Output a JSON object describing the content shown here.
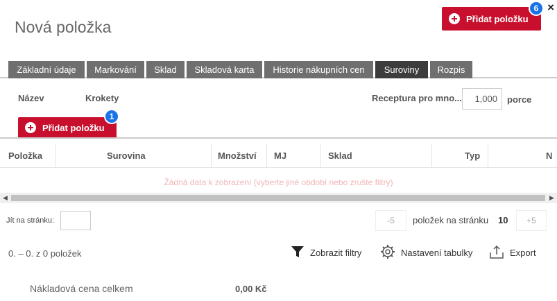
{
  "dialog": {
    "title": "Nová položka",
    "close_symbol": "×"
  },
  "header_button": {
    "label": "Přidat položku",
    "badge": "6",
    "icon": "plus-circle-icon"
  },
  "tabs": [
    {
      "label": "Základní údaje",
      "active": false
    },
    {
      "label": "Markování",
      "active": false
    },
    {
      "label": "Sklad",
      "active": false
    },
    {
      "label": "Skladová karta",
      "active": false
    },
    {
      "label": "Historie nákupních cen",
      "active": false
    },
    {
      "label": "Suroviny",
      "active": true
    },
    {
      "label": "Rozpis",
      "active": false
    }
  ],
  "form": {
    "name_label": "Název",
    "name_value": "Krokety",
    "recipe_label": "Receptura pro mno...",
    "recipe_value": "1,000",
    "recipe_unit": "porce"
  },
  "add_button": {
    "label": "Přidat položku",
    "badge": "1",
    "icon": "plus-circle-icon"
  },
  "table": {
    "columns": [
      "Položka",
      "Surovina",
      "Množství",
      "MJ",
      "Sklad",
      "Typ",
      "N"
    ],
    "empty_message": "Žádná data k zobrazení (vyberte jiné období nebo zrušte filtry)"
  },
  "scrollbar": {
    "left_arrow": "◀",
    "right_arrow": "▶"
  },
  "pagination": {
    "goto_label": "Jít na stránku:",
    "goto_value": "",
    "prev_label": "-5",
    "per_page_label": "položek na stránku",
    "per_page_value": "10",
    "next_label": "+5"
  },
  "footer": {
    "range_text": "0. – 0. z 0 položek",
    "filters_label": "Zobrazit filtry",
    "filters_icon": "funnel-icon",
    "settings_label": "Nastavení tabulky",
    "settings_icon": "gear-icon",
    "export_label": "Export",
    "export_icon": "upload-icon"
  },
  "summary": {
    "total_label": "Nákladová cena celkem",
    "total_value": "0,00 Kč"
  },
  "colors": {
    "accent_red": "#c8102e",
    "badge_blue": "#1a73e8",
    "tab_gray": "#6f6f6f",
    "tab_active": "#3c3c3c"
  }
}
